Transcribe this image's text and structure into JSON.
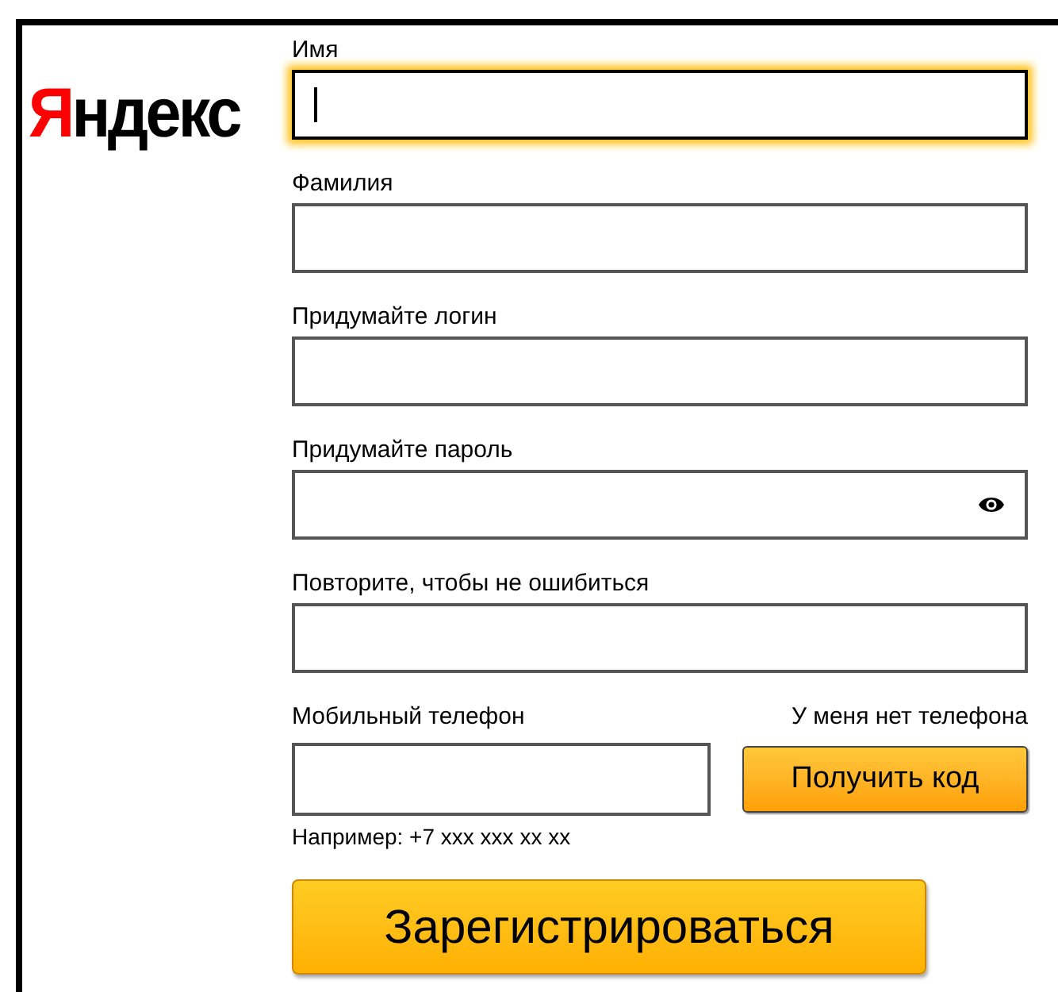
{
  "logo": {
    "first": "Я",
    "rest": "ндекс"
  },
  "fields": [
    {
      "label": "Имя",
      "kind": "text",
      "focused": true
    },
    {
      "label": "Фамилия",
      "kind": "text",
      "focused": false
    },
    {
      "label": "Придумайте логин",
      "kind": "text",
      "focused": false
    },
    {
      "label": "Придумайте пароль",
      "kind": "password",
      "focused": false
    },
    {
      "label": "Повторите, чтобы не ошибиться",
      "kind": "text",
      "focused": false
    }
  ],
  "phone": {
    "label": "Мобильный телефон",
    "no_phone_link": "У меня нет телефона",
    "button": "Получить код",
    "hint": "Например: +7 xxx xxx xx xx"
  },
  "submit": "Зарегистрироваться"
}
